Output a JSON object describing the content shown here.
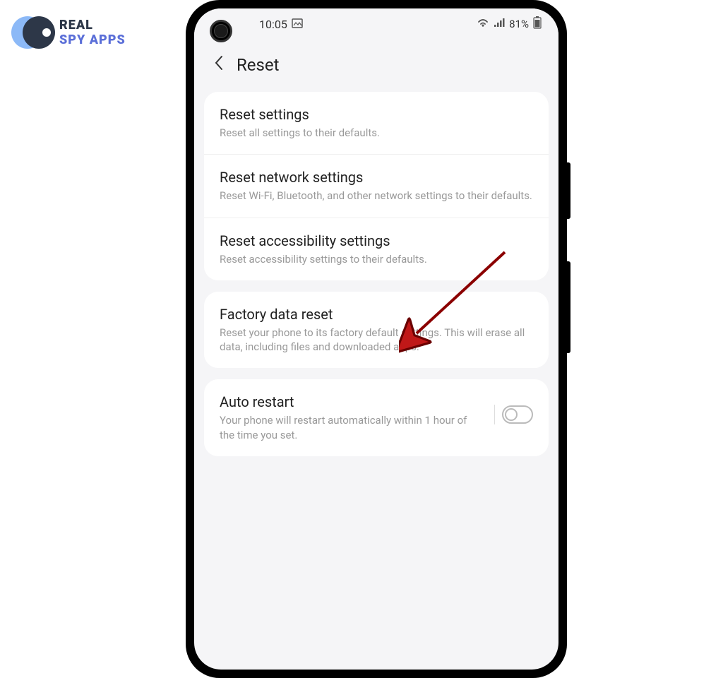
{
  "logo": {
    "line1": "REAL",
    "line2": "SPY APPS"
  },
  "status_bar": {
    "time": "10:05",
    "battery_text": "81%"
  },
  "header": {
    "title": "Reset",
    "back_icon": "‹"
  },
  "cards": [
    [
      {
        "title": "Reset settings",
        "desc": "Reset all settings to their defaults."
      },
      {
        "title": "Reset network settings",
        "desc": "Reset Wi-Fi, Bluetooth, and other network settings to their defaults."
      },
      {
        "title": "Reset accessibility settings",
        "desc": "Reset accessibility settings to their defaults."
      }
    ],
    [
      {
        "title": "Factory data reset",
        "desc": "Reset your phone to its factory default settings. This will erase all data, including files and downloaded apps."
      }
    ],
    [
      {
        "title": "Auto restart",
        "desc": "Your phone will restart automatically within 1 hour of the time you set.",
        "has_toggle": true,
        "toggle_on": false
      }
    ]
  ]
}
